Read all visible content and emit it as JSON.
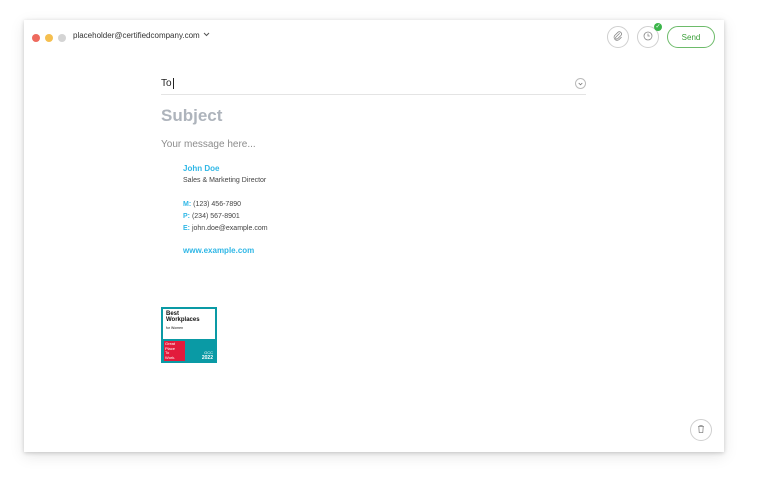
{
  "window": {
    "from_account": "placeholder@certifiedcompany.com"
  },
  "toolbar": {
    "send_label": "Send"
  },
  "compose": {
    "to_label": "To",
    "subject_placeholder": "Subject",
    "message_placeholder": "Your message here..."
  },
  "signature": {
    "name": "John Doe",
    "title": "Sales & Marketing Director",
    "mobile_key": "M:",
    "mobile": "(123) 456-7890",
    "phone_key": "P:",
    "phone": "(234) 567-8901",
    "email_key": "E:",
    "email": "john.doe@example.com",
    "website": "www.example.com"
  },
  "badge": {
    "line1": "Best",
    "line2": "Workplaces",
    "for_text": "for Women",
    "red_text": [
      "Great",
      "Place",
      "To",
      "Work."
    ],
    "region": "GCC",
    "year": "2022"
  },
  "colors": {
    "accent": "#2fb7e6",
    "send_green": "#3a9f38",
    "badge_teal": "#0a9aa5",
    "badge_red": "#e21b3c"
  },
  "icons": [
    "attachment-icon",
    "schedule-clock-icon",
    "check-icon",
    "chevron-down-icon",
    "trash-icon"
  ]
}
